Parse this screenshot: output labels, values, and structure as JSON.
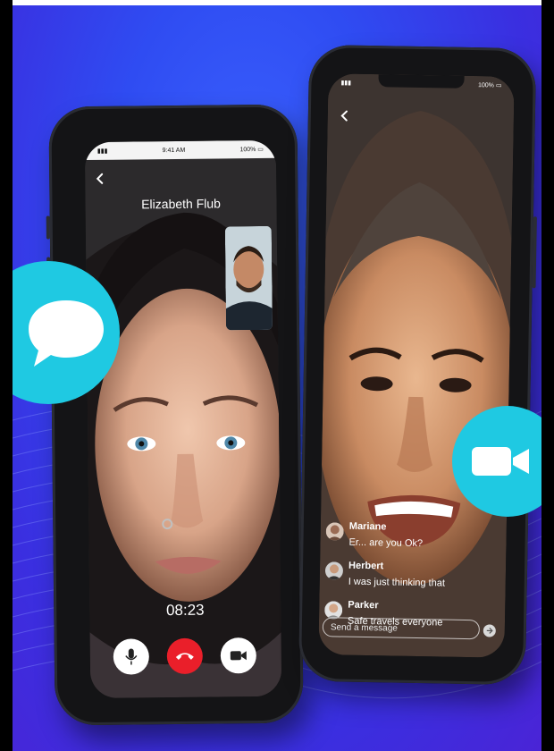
{
  "left_phone": {
    "status_time": "9:41 AM",
    "status_battery": "100%",
    "caller_name": "Elizabeth Flub",
    "call_timer": "08:23",
    "controls": {
      "mic": "microphone-icon",
      "end": "end-call-icon",
      "camera": "video-camera-icon"
    }
  },
  "right_phone": {
    "status_battery": "100%",
    "messages": [
      {
        "name": "Mariane",
        "text": "Er... are you Ok?"
      },
      {
        "name": "Herbert",
        "text": "I was just thinking that"
      },
      {
        "name": "Parker",
        "text": "Safe travels everyone"
      }
    ],
    "compose_placeholder": "Send a message"
  },
  "badges": {
    "left": "chat-bubble-icon",
    "right": "video-camera-icon"
  },
  "colors": {
    "background": "#2f4cf2",
    "badge": "#1fc9e2",
    "end_call": "#ea1f2a"
  }
}
